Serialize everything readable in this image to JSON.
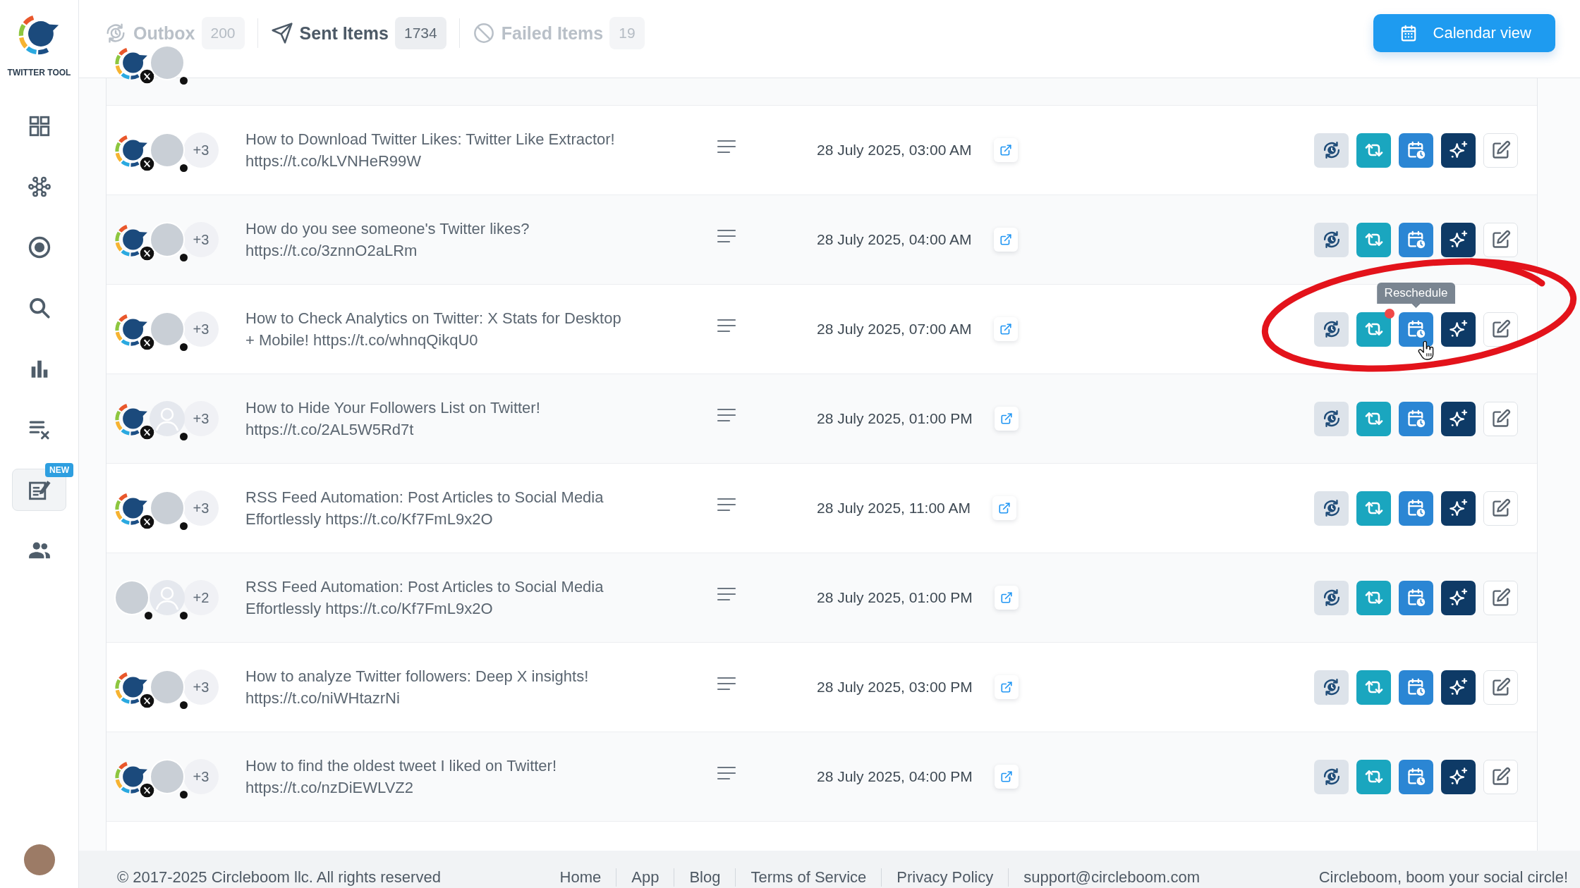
{
  "sidebar": {
    "brand": "TWITTER TOOL",
    "items": [
      {
        "selected": false
      },
      {
        "selected": false
      },
      {
        "selected": false
      },
      {
        "selected": false
      },
      {
        "selected": false
      },
      {
        "selected": false
      },
      {
        "selected": true,
        "badge": "NEW"
      },
      {
        "selected": false
      }
    ]
  },
  "tabs": [
    {
      "label": "Outbox",
      "count": "200",
      "selected": false
    },
    {
      "label": "Sent Items",
      "count": "1734",
      "selected": true
    },
    {
      "label": "Failed Items",
      "count": "19",
      "selected": false
    }
  ],
  "calendar_button": {
    "label": "Calendar view"
  },
  "table": {
    "partial_row": {
      "avatars": [
        {
          "kind": "logo",
          "x_badge": true,
          "dot": false
        },
        {
          "kind": "photo",
          "x_badge": false,
          "dot": true
        }
      ]
    },
    "rows": [
      {
        "avatars": [
          {
            "kind": "logo",
            "x_badge": true,
            "dot": false
          },
          {
            "kind": "photo",
            "x_badge": false,
            "dot": true
          }
        ],
        "more_count": "+3",
        "text": "How to Download Twitter Likes: Twitter Like Extractor! https://t.co/kLVNHeR99W",
        "date": "28 July 2025, 03:00 AM",
        "notification": false,
        "hovered": false,
        "highlighted": false
      },
      {
        "avatars": [
          {
            "kind": "logo",
            "x_badge": true,
            "dot": false
          },
          {
            "kind": "photo",
            "x_badge": false,
            "dot": true
          }
        ],
        "more_count": "+3",
        "text": "How do you see someone's Twitter likes? https://t.co/3znnO2aLRm",
        "date": "28 July 2025, 04:00 AM",
        "notification": false,
        "hovered": false,
        "highlighted": false
      },
      {
        "avatars": [
          {
            "kind": "logo",
            "x_badge": true,
            "dot": false
          },
          {
            "kind": "photo",
            "x_badge": false,
            "dot": true
          }
        ],
        "more_count": "+3",
        "text": "How to Check Analytics on Twitter: X Stats for Desktop + Mobile! https://t.co/whnqQikqU0",
        "date": "28 July 2025, 07:00 AM",
        "notification": true,
        "hovered": true,
        "highlighted": true,
        "tooltip": "Reschedule"
      },
      {
        "avatars": [
          {
            "kind": "logo",
            "x_badge": true,
            "dot": false
          },
          {
            "kind": "silhouette",
            "x_badge": false,
            "dot": true
          }
        ],
        "more_count": "+3",
        "text": "How to Hide Your Followers List on Twitter! https://t.co/2AL5W5Rd7t",
        "date": "28 July 2025, 01:00 PM",
        "notification": false,
        "hovered": false,
        "highlighted": false
      },
      {
        "avatars": [
          {
            "kind": "logo",
            "x_badge": true,
            "dot": false
          },
          {
            "kind": "photo",
            "x_badge": false,
            "dot": true
          }
        ],
        "more_count": "+3",
        "text": "RSS Feed Automation: Post Articles to Social Media Effortlessly https://t.co/Kf7FmL9x2O",
        "date": "28 July 2025, 11:00 AM",
        "notification": false,
        "hovered": false,
        "highlighted": false
      },
      {
        "avatars": [
          {
            "kind": "photo",
            "x_badge": false,
            "dot": true
          },
          {
            "kind": "silhouette",
            "x_badge": false,
            "dot": true
          }
        ],
        "more_count": "+2",
        "text": "RSS Feed Automation: Post Articles to Social Media Effortlessly https://t.co/Kf7FmL9x2O",
        "date": "28 July 2025, 01:00 PM",
        "notification": false,
        "hovered": false,
        "highlighted": false
      },
      {
        "avatars": [
          {
            "kind": "logo",
            "x_badge": true,
            "dot": false
          },
          {
            "kind": "photo",
            "x_badge": false,
            "dot": true
          }
        ],
        "more_count": "+3",
        "text": "How to analyze Twitter followers: Deep X insights! https://t.co/niWHtazrNi",
        "date": "28 July 2025, 03:00 PM",
        "notification": false,
        "hovered": false,
        "highlighted": false
      },
      {
        "avatars": [
          {
            "kind": "logo",
            "x_badge": true,
            "dot": false
          },
          {
            "kind": "photo",
            "x_badge": false,
            "dot": true
          }
        ],
        "more_count": "+3",
        "text": "How to find the oldest tweet I liked on Twitter! https://t.co/nzDiEWLVZ2",
        "date": "28 July 2025, 04:00 PM",
        "notification": false,
        "hovered": false,
        "highlighted": false
      }
    ]
  },
  "footer": {
    "copyright": "© 2017-2025 Circleboom llc. All rights reserved",
    "links": [
      "Home",
      "App",
      "Blog",
      "Terms of Service",
      "Privacy Policy",
      "support@circleboom.com"
    ],
    "tagline": "Circleboom, boom your social circle!"
  }
}
